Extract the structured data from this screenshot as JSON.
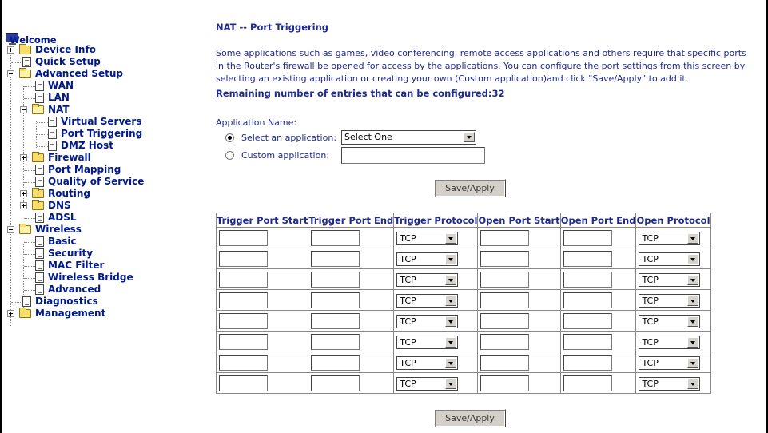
{
  "sidebar": {
    "items": [
      {
        "label": "Welcome"
      },
      {
        "label": "Device Info"
      },
      {
        "label": "Quick Setup"
      },
      {
        "label": "Advanced Setup"
      },
      {
        "label": "WAN"
      },
      {
        "label": "LAN"
      },
      {
        "label": "NAT"
      },
      {
        "label": "Virtual Servers"
      },
      {
        "label": "Port Triggering"
      },
      {
        "label": "DMZ Host"
      },
      {
        "label": "Firewall"
      },
      {
        "label": "Port Mapping"
      },
      {
        "label": "Quality of Service"
      },
      {
        "label": "Routing"
      },
      {
        "label": "DNS"
      },
      {
        "label": "ADSL"
      },
      {
        "label": "Wireless"
      },
      {
        "label": "Basic"
      },
      {
        "label": "Security"
      },
      {
        "label": "MAC Filter"
      },
      {
        "label": "Wireless Bridge"
      },
      {
        "label": "Advanced"
      },
      {
        "label": "Diagnostics"
      },
      {
        "label": "Management"
      }
    ]
  },
  "main": {
    "title": "NAT -- Port Triggering",
    "intro": "Some applications such as games, video conferencing, remote access applications and others require that specific ports in the Router's firewall be opened for access by the applications. You can configure the port settings from this screen by selecting an existing application or creating your own (Custom application)and click \"Save/Apply\" to add it.",
    "remaining": "Remaining number of entries that can be configured:32",
    "app_name_label": "Application Name:",
    "select_label": "Select an application:",
    "select_value": "Select One",
    "custom_label": "Custom application:",
    "custom_value": "",
    "save_label": "Save/Apply"
  },
  "table": {
    "headers": [
      "Trigger Port Start",
      "Trigger Port End",
      "Trigger Protocol",
      "Open Port Start",
      "Open Port End",
      "Open Protocol"
    ],
    "rows": [
      {
        "trigger_start": "",
        "trigger_end": "",
        "trigger_protocol": "TCP",
        "open_start": "",
        "open_end": "",
        "open_protocol": "TCP"
      },
      {
        "trigger_start": "",
        "trigger_end": "",
        "trigger_protocol": "TCP",
        "open_start": "",
        "open_end": "",
        "open_protocol": "TCP"
      },
      {
        "trigger_start": "",
        "trigger_end": "",
        "trigger_protocol": "TCP",
        "open_start": "",
        "open_end": "",
        "open_protocol": "TCP"
      },
      {
        "trigger_start": "",
        "trigger_end": "",
        "trigger_protocol": "TCP",
        "open_start": "",
        "open_end": "",
        "open_protocol": "TCP"
      },
      {
        "trigger_start": "",
        "trigger_end": "",
        "trigger_protocol": "TCP",
        "open_start": "",
        "open_end": "",
        "open_protocol": "TCP"
      },
      {
        "trigger_start": "",
        "trigger_end": "",
        "trigger_protocol": "TCP",
        "open_start": "",
        "open_end": "",
        "open_protocol": "TCP"
      },
      {
        "trigger_start": "",
        "trigger_end": "",
        "trigger_protocol": "TCP",
        "open_start": "",
        "open_end": "",
        "open_protocol": "TCP"
      },
      {
        "trigger_start": "",
        "trigger_end": "",
        "trigger_protocol": "TCP",
        "open_start": "",
        "open_end": "",
        "open_protocol": "TCP"
      }
    ]
  }
}
